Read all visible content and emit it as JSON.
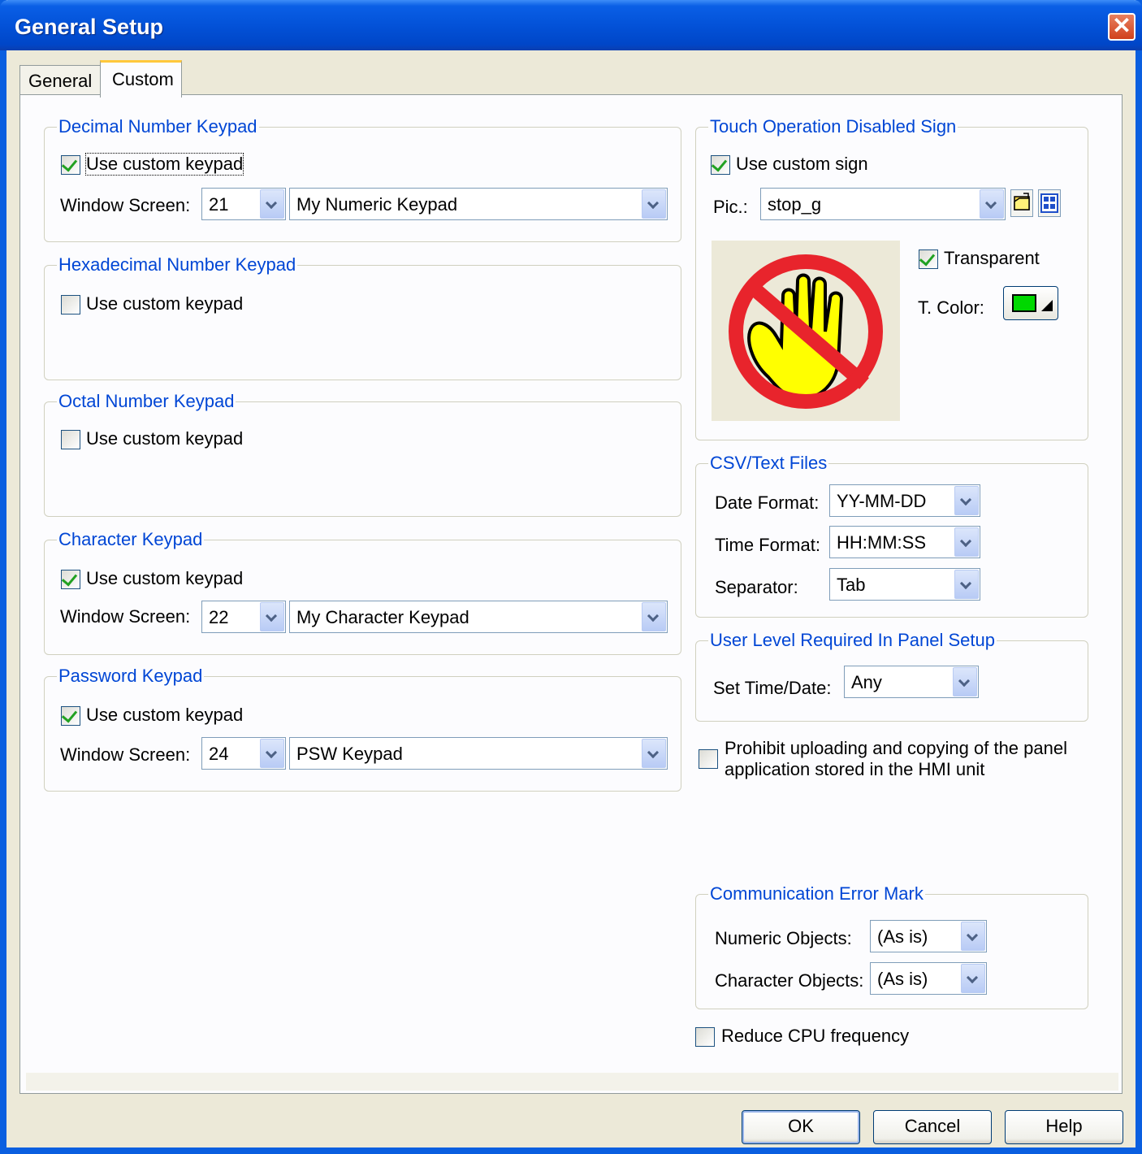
{
  "window": {
    "title": "General Setup"
  },
  "tabs": [
    {
      "label": "General"
    },
    {
      "label": "Custom"
    }
  ],
  "decimal": {
    "title": "Decimal Number Keypad",
    "checkbox": "Use custom keypad",
    "checked": true,
    "screen_label": "Window Screen:",
    "screen_num": "21",
    "screen_name": "My Numeric Keypad"
  },
  "hexadecimal": {
    "title": "Hexadecimal Number Keypad",
    "checkbox": "Use custom keypad",
    "checked": false
  },
  "octal": {
    "title": "Octal Number Keypad",
    "checkbox": "Use custom keypad",
    "checked": false
  },
  "character": {
    "title": "Character Keypad",
    "checkbox": "Use custom keypad",
    "checked": true,
    "screen_label": "Window Screen:",
    "screen_num": "22",
    "screen_name": "My Character Keypad"
  },
  "password": {
    "title": "Password Keypad",
    "checkbox": "Use custom keypad",
    "checked": true,
    "screen_label": "Window Screen:",
    "screen_num": "24",
    "screen_name": "PSW Keypad"
  },
  "touch_sign": {
    "title": "Touch Operation Disabled Sign",
    "checkbox": "Use custom sign",
    "checked": true,
    "pic_label": "Pic.:",
    "pic_value": "stop_g",
    "transparent_label": "Transparent",
    "transparent_checked": true,
    "tcolor_label": "T. Color:",
    "tcolor": "#00d800"
  },
  "csv": {
    "title": "CSV/Text Files",
    "date_label": "Date Format:",
    "date_value": "YY-MM-DD",
    "time_label": "Time Format:",
    "time_value": "HH:MM:SS",
    "sep_label": "Separator:",
    "sep_value": "Tab"
  },
  "user_level": {
    "title": "User Level Required In Panel Setup",
    "label": "Set Time/Date:",
    "value": "Any"
  },
  "prohibit": {
    "line1": "Prohibit uploading and copying of the panel",
    "line2": "application stored in the HMI unit",
    "checked": false
  },
  "comm_error": {
    "title": "Communication Error Mark",
    "numeric_label": "Numeric Objects:",
    "numeric_value": "(As is)",
    "character_label": "Character Objects:",
    "character_value": "(As is)"
  },
  "reduce_cpu": {
    "label": "Reduce CPU frequency",
    "checked": false
  },
  "buttons": {
    "ok": "OK",
    "cancel": "Cancel",
    "help": "Help"
  }
}
